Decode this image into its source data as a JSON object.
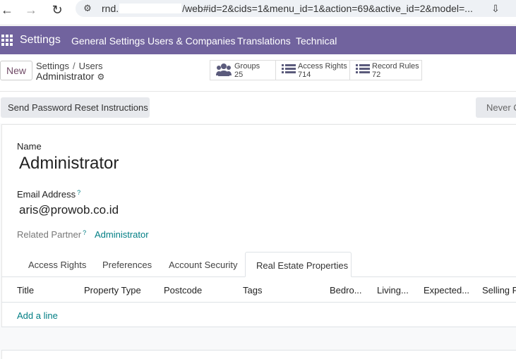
{
  "browser": {
    "url_prefix": "rnd.",
    "url_suffix": "/web#id=2&cids=1&menu_id=1&action=69&active_id=2&model=..."
  },
  "navbar": {
    "app": "Settings",
    "menus": [
      "General Settings",
      "Users & Companies",
      "Translations",
      "Technical"
    ],
    "bg_color": "#71639e"
  },
  "control": {
    "new_label": "New",
    "breadcrumb": [
      "Settings",
      "Users"
    ],
    "record": "Administrator"
  },
  "stats": [
    {
      "icon": "users-icon",
      "label": "Groups",
      "value": "25"
    },
    {
      "icon": "list-icon",
      "label": "Access Rights",
      "value": "714"
    },
    {
      "icon": "list-icon",
      "label": "Record Rules",
      "value": "72"
    }
  ],
  "actions": {
    "reset_password": "Send Password Reset Instructions",
    "never": "Never C"
  },
  "form": {
    "name_label": "Name",
    "name_value": "Administrator",
    "email_label": "Email Address",
    "email_value": "aris@prowob.co.id",
    "help": "?",
    "partner_label": "Related Partner",
    "partner_value": "Administrator"
  },
  "tabs": [
    "Access Rights",
    "Preferences",
    "Account Security",
    "Real Estate Properties"
  ],
  "table": {
    "columns": [
      "Title",
      "Property Type",
      "Postcode",
      "Tags",
      "Bedro...",
      "Living...",
      "Expected...",
      "Selling P"
    ],
    "add_line": "Add a line"
  }
}
